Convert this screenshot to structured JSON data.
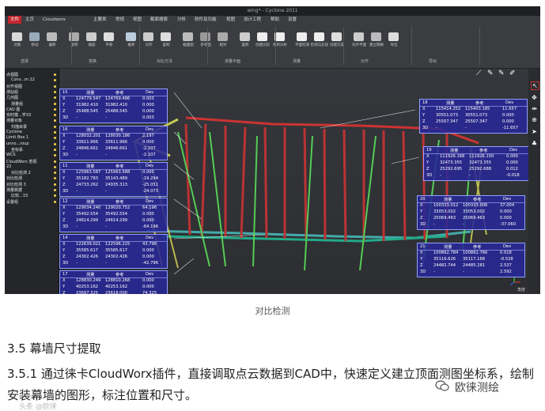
{
  "window": {
    "title": "wing* - Cyclone 2011"
  },
  "menu": [
    "文件",
    "主页",
    "Cloudworx",
    "主要类",
    "常规",
    "视图",
    "截面搜索",
    "分析",
    "软件及功能",
    "视图",
    "设计工程",
    "帮助",
    "设置"
  ],
  "menu_active_index": 0,
  "ribbon": {
    "buttons": [
      "对象",
      "移动",
      "偏移",
      "旋转",
      "缩放",
      "平移",
      "推移",
      "对齐",
      "复制",
      "截面图",
      "参考面",
      "相对",
      "面积",
      "创建比较",
      "体积分析",
      "平面检测",
      "检测与比较",
      "创建方案",
      "对齐平面",
      "建立网格",
      "导出"
    ],
    "groups": [
      "选择",
      "变换",
      "对比方法",
      "测量平面",
      "测量",
      "对齐",
      "导出"
    ]
  },
  "tree": [
    "点视图",
    "Conv...m 22",
    "对齐视图",
    "测站组",
    "几何图",
    "测量组",
    "CAD 图",
    "实时模...学33",
    "测量对象",
    "扫描目录",
    "Cyclone",
    "Limit Box 1",
    "unno...roup",
    "坐标系",
    "WCS",
    "CloudWorx 若视",
    "22",
    "对比检测 2",
    "对比检测",
    "对比检测 3",
    "测量数据",
    "比较...33",
    "设置组"
  ],
  "panels": [
    {
      "id": "15",
      "h": [
        "测量",
        "参考",
        "Dev"
      ],
      "rows": [
        [
          "X",
          "124779.547",
          "124769.486",
          "0.003"
        ],
        [
          "Y",
          "31982.410",
          "31982.410",
          "0.000"
        ],
        [
          "Z",
          "25488.545",
          "25488.545",
          "0.000"
        ],
        [
          "3D",
          "-",
          "-",
          "0.003"
        ]
      ]
    },
    {
      "id": "16",
      "h": [
        "测量",
        "参考",
        "Dev"
      ],
      "rows": [
        [
          "X",
          "128032.201",
          "128030.186",
          "2.197"
        ],
        [
          "Y",
          "33611.966",
          "33611.966",
          "0.000"
        ],
        [
          "Z",
          "24846.661",
          "24846.661",
          "-2.107"
        ],
        [
          "3D",
          "-",
          "-",
          "-2.107"
        ]
      ]
    },
    {
      "id": "11",
      "h": [
        "测量",
        "参考",
        "Dev"
      ],
      "rows": [
        [
          "X",
          "125963.587",
          "125963.588",
          "0.000"
        ],
        [
          "Y",
          "35182.783",
          "35143.489",
          "-19.294"
        ],
        [
          "Z",
          "24733.262",
          "24935.313",
          "-25.051"
        ],
        [
          "3D",
          "-",
          "-",
          "-24.073"
        ]
      ]
    },
    {
      "id": "12",
      "h": [
        "测量",
        "参考",
        "Dev"
      ],
      "rows": [
        [
          "X",
          "129034.240",
          "129020.752",
          "64.196"
        ],
        [
          "Y",
          "35492.554",
          "35492.554",
          "0.000"
        ],
        [
          "Z",
          "24614.299",
          "24614.299",
          "0.000"
        ],
        [
          "3D",
          "-",
          "-",
          "-64.196"
        ]
      ]
    },
    {
      "id": "14",
      "h": [
        "测量",
        "参考",
        "Dev"
      ],
      "rows": [
        [
          "X",
          "122639.021",
          "122596.225",
          "43.796"
        ],
        [
          "Y",
          "35585.617",
          "35585.617",
          "0.000"
        ],
        [
          "Z",
          "24302.426",
          "24302.426",
          "0.000"
        ],
        [
          "3D",
          "-",
          "-",
          "-42.796"
        ]
      ]
    },
    {
      "id": "17",
      "h": [
        "测量",
        "参考",
        "Dev"
      ],
      "rows": [
        [
          "X",
          "128830.249",
          "128810.268",
          "0.000"
        ],
        [
          "Y",
          "40253.162",
          "40253.162",
          "0.000"
        ],
        [
          "Z",
          "23697.325",
          "23618.000",
          "74.325"
        ],
        [
          "3D",
          "-",
          "-",
          "-74.325"
        ]
      ]
    },
    {
      "id": "18",
      "h": [
        "测量",
        "参考",
        "Dev"
      ],
      "rows": [
        [
          "X",
          "115414.252",
          "115403.185",
          "11.657"
        ],
        [
          "Y",
          "30551.073",
          "30551.073",
          "0.000"
        ],
        [
          "Z",
          "25507.347",
          "25507.347",
          "0.000"
        ],
        [
          "3D",
          "-",
          "-",
          "-11.657"
        ]
      ]
    },
    {
      "id": "19",
      "h": [
        "测量",
        "参考",
        "Dev"
      ],
      "rows": [
        [
          "X",
          "111926.168",
          "111926.150",
          "0.000"
        ],
        [
          "Y",
          "32473.355",
          "32473.355",
          "0.000"
        ],
        [
          "Z",
          "25292.695",
          "25292.688",
          "0.012"
        ],
        [
          "3D",
          "-",
          "-",
          "-0.018"
        ]
      ]
    },
    {
      "id": "20",
      "h": [
        "测量",
        "参考",
        "Dev"
      ],
      "rows": [
        [
          "X",
          "100333.012",
          "100333.006",
          "37.004"
        ],
        [
          "Y",
          "33053.002",
          "33053.002",
          "0.000"
        ],
        [
          "Z",
          "25069.463",
          "25069.463",
          "0.000"
        ],
        [
          "3D",
          "-",
          "-",
          "-37.060"
        ]
      ]
    },
    {
      "id": "21",
      "h": [
        "测量",
        "参考",
        "Dev"
      ],
      "rows": [
        [
          "X",
          "100862.784",
          "100862.766",
          "0.018"
        ],
        [
          "Y",
          "35116.626",
          "35117.168",
          "-0.528"
        ],
        [
          "Z",
          "24482.744",
          "24485.281",
          "2.537"
        ],
        [
          "3D",
          "-",
          "-",
          "2.592"
        ]
      ]
    }
  ],
  "status": {
    "view_label": "角度"
  },
  "caption": "对比检测",
  "section_heading": "3.5 幕墙尺寸提取",
  "section_body": "3.5.1 通过徕卡CloudWorx插件，直接调取点云数据到CAD中，快速定义建立顶面测图坐标系，绘制安装幕墙的图形，标注位置和尺寸。",
  "watermark": "欧徕测绘",
  "watermark_small": "头条 @欧徕"
}
